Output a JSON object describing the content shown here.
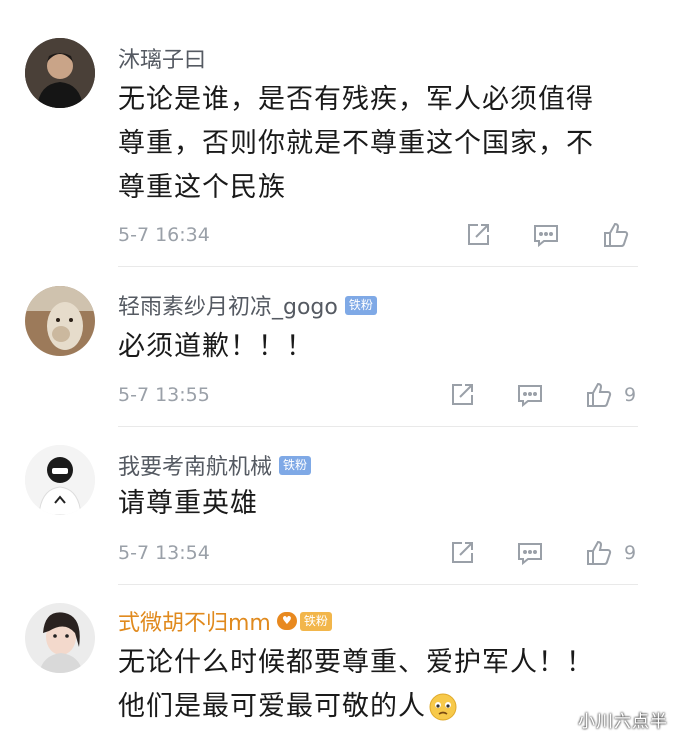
{
  "comments": [
    {
      "username": "沐璃子曰",
      "lines": [
        "无论是谁，是否有残疾，军人必须值得",
        "尊重，否则你就是不尊重这个国家，不",
        "尊重这个民族"
      ],
      "time": "5-7 16:34",
      "likes": ""
    },
    {
      "username": "轻雨素纱月初凉_gogo",
      "badge": "铁粉",
      "lines": [
        "必须道歉！！！"
      ],
      "time": "5-7 13:55",
      "likes": "9"
    },
    {
      "username": "我要考南航机械",
      "badge": "铁粉",
      "lines": [
        "请尊重英雄"
      ],
      "time": "5-7 13:54",
      "likes": "9"
    },
    {
      "username": "式微胡不归mm",
      "badge": "铁粉",
      "lines": [
        "无论什么时候都要尊重、爱护军人！！",
        "他们是最可爱最可敬的人"
      ]
    }
  ],
  "watermark": "小川六点半",
  "colors": {
    "username": "#555a62",
    "username_gold": "#e08a1e",
    "badge": "#7fa9e6",
    "badge_gold": "#f2b64b",
    "meta": "#9aa0a8"
  },
  "icons": [
    "share-icon",
    "comment-icon",
    "like-icon",
    "emoji-icon",
    "fan-heart-icon"
  ]
}
